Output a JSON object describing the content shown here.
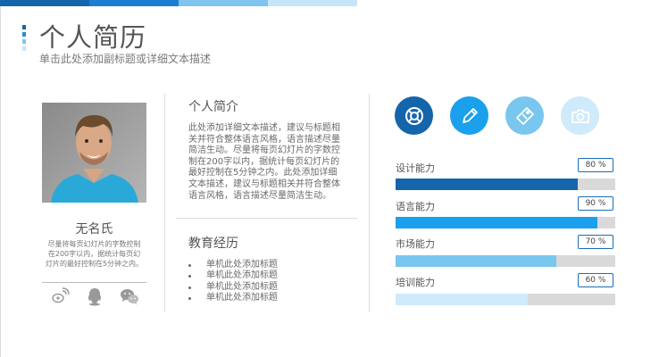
{
  "colors": {
    "strip": [
      "#1565ab",
      "#1a7fd0",
      "#7ec4ee",
      "#c6e6f8"
    ],
    "accent_dots": [
      "#1565ab",
      "#1e90e0",
      "#7ec4ee",
      "#c6e6f8"
    ],
    "icon_circles": [
      "#1565ab",
      "#1aa0ec",
      "#79c6ef",
      "#cfeafa"
    ],
    "skill_fills": [
      "#1565ab",
      "#1aa0ec",
      "#79c6ef",
      "#cfeafa"
    ]
  },
  "header": {
    "title": "个人简历",
    "subtitle": "单击此处添加副标题或详细文本描述"
  },
  "profile": {
    "name": "无名氏",
    "description": "尽量将每页幻灯片的字数控制在200字以内，据统计每页幻灯片的最好控制在5分钟之内。",
    "social_icons": [
      "weibo-icon",
      "qq-icon",
      "wechat-icon"
    ]
  },
  "intro": {
    "title": "个人简介",
    "text": "此处添加详细文本描述，建议与标题相关并符合整体语言风格，语言描述尽量简洁生动。尽量将每页幻灯片的字数控制在200字以内，据统计每页幻灯片的最好控制在5分钟之内。此处添加详细文本描述，建议与标题相关并符合整体语言风格，语言描述尽量简洁生动。"
  },
  "education": {
    "title": "教育经历",
    "items": [
      "单机此处添加标题",
      "单机此处添加标题",
      "单机此处添加标题",
      "单机此处添加标题"
    ]
  },
  "skill_icons": [
    "lifebuoy-icon",
    "pencil-icon",
    "ticket-icon",
    "camera-icon"
  ],
  "skills": [
    {
      "label": "设计能力",
      "percent_text": "80 %",
      "value": 0.83
    },
    {
      "label": "语言能力",
      "percent_text": "90 %",
      "value": 0.92
    },
    {
      "label": "市场能力",
      "percent_text": "70 %",
      "value": 0.73
    },
    {
      "label": "培训能力",
      "percent_text": "60 %",
      "value": 0.6
    }
  ]
}
